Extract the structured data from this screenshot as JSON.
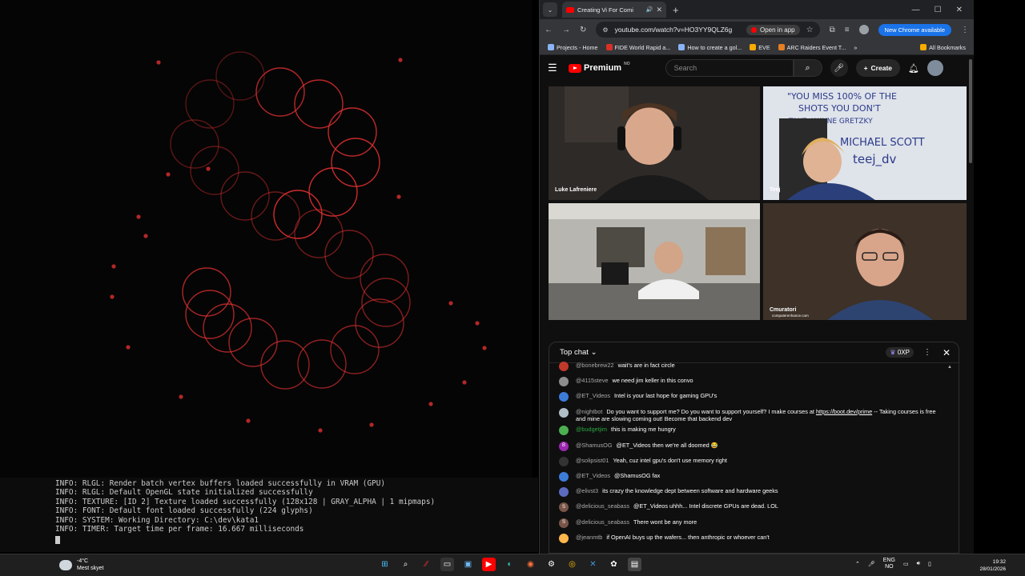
{
  "terminal": {
    "lines": [
      "INFO: RLGL: Render batch vertex buffers loaded successfully in VRAM (GPU)",
      "INFO: RLGL: Default OpenGL state initialized successfully",
      "INFO: TEXTURE: [ID 2] Texture loaded successfully (128x128 | GRAY_ALPHA | 1 mipmaps)",
      "INFO: FONT: Default font loaded successfully (224 glyphs)",
      "INFO: SYSTEM: Working Directory: C:\\dev\\kata1",
      "INFO: TIMER: Target time per frame: 16.667 milliseconds"
    ]
  },
  "browser": {
    "tab_title": "Creating Vi For Comi",
    "url": "youtube.com/watch?v=HO3YY9QLZ6g",
    "open_in_app": "Open in app",
    "new_chrome": "New Chrome available",
    "bookmarks": [
      "Projects - Home",
      "FIDE World Rapid a...",
      "How to create a gol...",
      "EVE",
      "ARC Raiders Event T..."
    ],
    "all_bookmarks": "All Bookmarks"
  },
  "youtube": {
    "logo": "Premium",
    "region": "NO",
    "search_placeholder": "Search",
    "create_label": "Create",
    "participants": [
      "Luke Lafreniere",
      "Teej",
      "",
      "Cmuratori"
    ],
    "participant_sub": "computerenhance.com",
    "whiteboard": [
      "\"YOU MISS 100% OF THE",
      "SHOTS YOU DON'T",
      "TAKE  -WAYNE GRETZKY",
      "MICHAEL SCOTT",
      "teej_dv"
    ]
  },
  "chat": {
    "title": "Top chat",
    "xp": "0XP",
    "messages": [
      {
        "author": "@bonebrew22",
        "text": "wait's are in fact circle",
        "color": "#c0392b",
        "initial": ""
      },
      {
        "author": "@4115steve",
        "text": "we need jim keller in this convo",
        "color": "#8d8d8d",
        "initial": ""
      },
      {
        "author": "@ET_Videos",
        "text": "Intel is your last hope for gaming GPU's",
        "color": "#3d7bd9",
        "initial": ""
      },
      {
        "author": "@nightbot",
        "text": "Do you want to support me? Do you want to support yourself? I make courses at ",
        "link": "https://boot.dev/prime",
        "after": " -- Taking courses is free and mine are slowing coming out! Become that backend dev",
        "color": "#b0bec5",
        "initial": ""
      },
      {
        "author": "@budgetjim",
        "text": "this is making me hungry",
        "color": "#4caf50",
        "initial": "",
        "author_color": "#2ba640"
      },
      {
        "author": "@ShamusOG",
        "text": "@ET_Videos then we're all doomed 😂",
        "color": "#9c27b0",
        "initial": "B"
      },
      {
        "author": "@solipsist01",
        "text": "Yeah, cuz intel gpu's don't use memory right",
        "color": "#333333",
        "initial": ""
      },
      {
        "author": "@ET_Videos",
        "text": "@ShamusOG fax",
        "color": "#3d7bd9",
        "initial": ""
      },
      {
        "author": "@elivst3",
        "text": "its crazy the knowledge dept between software and hardware geeks",
        "color": "#5c6bc0",
        "initial": ""
      },
      {
        "author": "@delicious_seabass",
        "text": "@ET_Videos uhhh... Intel discrete GPUs are dead. LOL",
        "color": "#795548",
        "initial": "S"
      },
      {
        "author": "@delicious_seabass",
        "text": "There wont be any more",
        "color": "#795548",
        "initial": "S"
      },
      {
        "author": "@jeanmtb",
        "text": "if OpenAI buys up the wafers... then anthropic or whoever can't",
        "color": "#ffb74d",
        "initial": ""
      }
    ]
  },
  "taskbar": {
    "temp": "-4°C",
    "weather": "Mest skyet",
    "lang_top": "ENG",
    "lang_bottom": "NO",
    "time": "19:32",
    "date": "28/01/2026"
  },
  "colors": {
    "ring": "#e03030",
    "yt_red": "#ff0000"
  }
}
